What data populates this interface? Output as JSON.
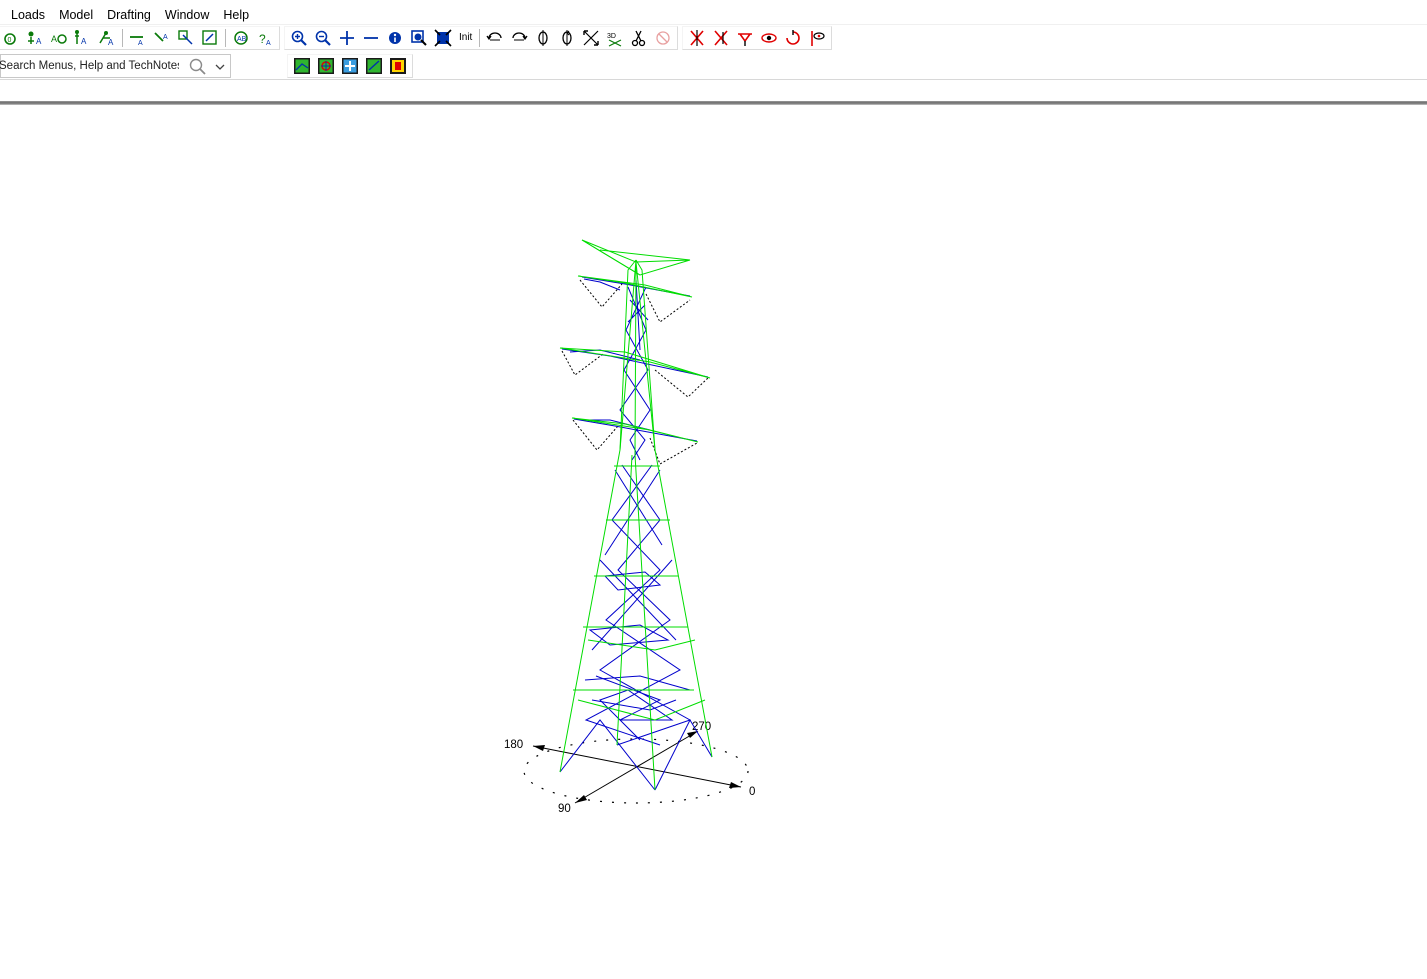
{
  "menu": {
    "items": [
      {
        "label": "Loads"
      },
      {
        "label": "Model"
      },
      {
        "label": "Drafting"
      },
      {
        "label": "Window"
      },
      {
        "label": "Help"
      }
    ]
  },
  "toolbar": {
    "init_label": "Init",
    "icons_group1": [
      "node-add-icon",
      "node-label-icon",
      "node-renumber-icon",
      "node-tag-icon",
      "node-attach-icon"
    ],
    "icons_group2": [
      "member-add-icon",
      "member-connect-icon",
      "member-edit-icon",
      "member-group-icon"
    ],
    "icons_group3": [
      "check-model-icon",
      "help-query-icon"
    ],
    "icons_zoom": [
      "zoom-in-icon",
      "zoom-out-icon",
      "pan-plus-icon",
      "pan-minus-icon",
      "view-info-icon",
      "zoom-window-icon",
      "zoom-extents-icon"
    ],
    "icons_rotate": [
      "rotate-left-icon",
      "rotate-down-icon",
      "rotate-x-icon",
      "rotate-y-icon",
      "fit-view-icon",
      "view-3d-icon",
      "cut-icon",
      "disabled-tool-icon"
    ],
    "icons_red": [
      "red-tool-1-icon",
      "red-tool-2-icon",
      "red-tool-3-icon",
      "red-tool-4-icon",
      "red-tool-5-icon",
      "red-tool-6-icon"
    ]
  },
  "search": {
    "placeholder": "Search Menus, Help and TechNotes"
  },
  "row2_icons": [
    "render-solid-icon",
    "render-section-icon",
    "render-plus-icon",
    "render-check-icon",
    "render-frame-icon"
  ],
  "compass": {
    "labels": {
      "north": "270",
      "south": "90",
      "east": "0",
      "west": "180"
    }
  },
  "colors": {
    "legs": "#00e000",
    "bracing": "#0000cc",
    "insulator": "#000000",
    "red_tool": "#e00000"
  }
}
